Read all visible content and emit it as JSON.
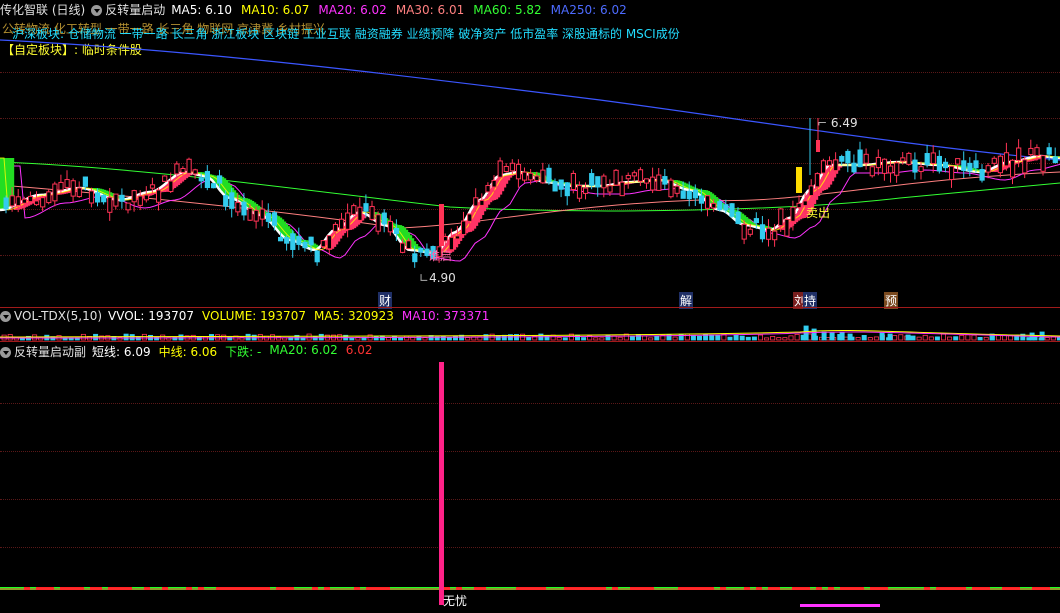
{
  "main_header": {
    "title": "传化智联 (日线)",
    "indicator": "反转量启动",
    "ma": [
      {
        "label": "MA5: 6.10",
        "color": "#ffffff"
      },
      {
        "label": "MA10: 6.07",
        "color": "#ffff00"
      },
      {
        "label": "MA20: 6.02",
        "color": "#ff33ff"
      },
      {
        "label": "MA30: 6.01",
        "color": "#ff8080"
      },
      {
        "label": "MA60: 5.82",
        "color": "#33ff33"
      },
      {
        "label": "MA250: 6.02",
        "color": "#4d6bff"
      }
    ]
  },
  "concepts": {
    "overlap_text": "公转物流 化工转型 一带一路 长三角 物联网 京津冀 乡村振兴",
    "line": "沪深板块: 仓储物流 一带一路 长三角 浙江板块 区块链 工业互联 融资融券 业绩预降 破净资产 低市盈率 深股通标的 MSCI成份",
    "custom": "【自定板块】: 临时条件股"
  },
  "price_labels": {
    "high": "6.49",
    "low": "4.90"
  },
  "signals": {
    "start": "谁启",
    "sell": "卖出",
    "bottom": "无忧"
  },
  "events": [
    {
      "label": "财",
      "bg": "#1f2f66",
      "color": "#ffffff"
    },
    {
      "label": "解",
      "bg": "#1f2f66",
      "color": "#ffffff"
    },
    {
      "label": "刘",
      "bg": "#7a1f1f",
      "color": "#ffffff"
    },
    {
      "label": "持",
      "bg": "#1f2f66",
      "color": "#ffffff"
    },
    {
      "label": "预",
      "bg": "#7a4a1f",
      "color": "#ffffff"
    }
  ],
  "vol_header": {
    "title": "VOL-TDX(5,10)",
    "items": [
      {
        "label": "VVOL: 193707",
        "color": "#ffffff"
      },
      {
        "label": "VOLUME: 193707",
        "color": "#ffff00"
      },
      {
        "label": "MA5: 320923",
        "color": "#ffff00"
      },
      {
        "label": "MA10: 373371",
        "color": "#ff33ff"
      }
    ]
  },
  "sub_header": {
    "title": "反转量启动副",
    "items": [
      {
        "label": "短线: 6.09",
        "color": "#ffffff"
      },
      {
        "label": "中线: 6.06",
        "color": "#ffff00"
      },
      {
        "label": "下跌: -",
        "color": "#33ff33"
      },
      {
        "label": "MA20: 6.02",
        "color": "#33ff33"
      },
      {
        "label": "6.02",
        "color": "#ff3333"
      }
    ]
  },
  "colors": {
    "up": "#ff3355",
    "down": "#33ccee",
    "ribbon_up": "#ff3366",
    "ribbon_down": "#22dd22",
    "separator": "#a01a1a"
  }
}
